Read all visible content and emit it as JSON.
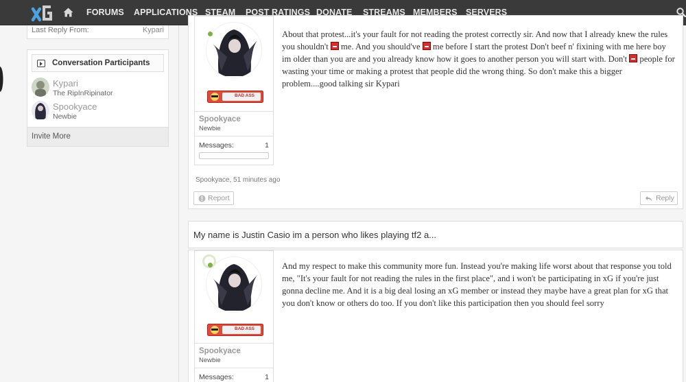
{
  "nav": {
    "logo": "xG",
    "items": [
      "FORUMS",
      "APPLICATIONS",
      "STEAM",
      "POST RATINGS",
      "DONATE",
      "STREAMS",
      "MEMBERS",
      "SERVERS"
    ]
  },
  "sidebar": {
    "last_reply_label": "Last Reply From:",
    "last_reply_user": "Kypari",
    "participants_title": "Conversation Participants",
    "participants": [
      {
        "name": "Kypari",
        "title": "The RipInRipinator"
      },
      {
        "name": "Spookyace",
        "title": "Newbie"
      }
    ],
    "invite": "Invite More"
  },
  "post1": {
    "username": "Spookyace",
    "usertitle": "Newbie",
    "badge": "BAD ASS",
    "messages_label": "Messages:",
    "messages_value": "1",
    "segments": [
      "About that protest...it's your fault for not reading the protest correctly sir. And now that I already knew the rules you shouldn't ",
      " me. And you should've ",
      " me before I start the protest Don't beef n' fixining with me here boy im older than you are and you already know how it goes to another person you will start with. Don't ",
      " people for wasting your time or making a protest that people did the wrong thing. So don't make this a bigger problem....good talking sir Kypari"
    ],
    "meta": "Spookyace, 51 minutes ago",
    "report": "Report",
    "reply": "Reply"
  },
  "intro": "My name is Justin Casio im a person who likes playing tf2 a...",
  "post2": {
    "username": "Spookyace",
    "usertitle": "Newbie",
    "badge": "BAD ASS",
    "messages_label": "Messages:",
    "messages_value": "1",
    "text": "And my respect to make this community more fun. Instead you're making life worst about that response you told me, \"It's your fault for not reading the rules in the first place\", and i won't be participating in xG if you're just gonna decline me. And it is a big deal losing an xG member or instead they maybe have a great plan for xG that you don't know or others do too. If you don't like this participation then you should feel sorry"
  }
}
